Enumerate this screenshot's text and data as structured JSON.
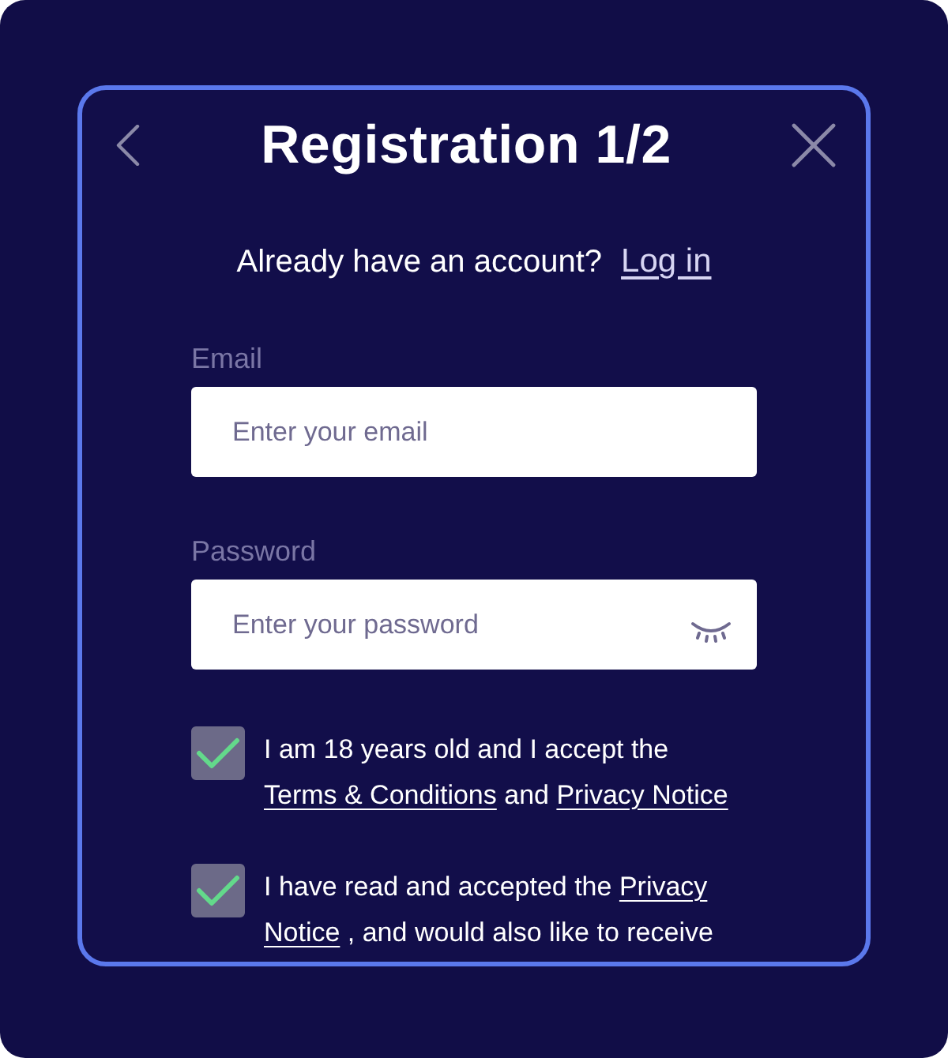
{
  "header": {
    "title": "Registration 1/2"
  },
  "login_prompt": {
    "text": "Already have an account?",
    "link": "Log in"
  },
  "fields": [
    {
      "kind": "email",
      "label": "Email",
      "placeholder": "Enter your email"
    },
    {
      "kind": "password",
      "label": "Password",
      "placeholder": "Enter your password"
    }
  ],
  "consents": [
    {
      "checked": true,
      "segments": [
        {
          "kind": "text",
          "text": "I am 18 years old and I accept the "
        },
        {
          "kind": "link",
          "text": "Terms & Conditions"
        },
        {
          "kind": "text",
          "text": " and "
        },
        {
          "kind": "link",
          "text": "Privacy Notice"
        }
      ]
    },
    {
      "checked": true,
      "segments": [
        {
          "kind": "text",
          "text": "I have read and accepted the "
        },
        {
          "kind": "link",
          "parts": [
            "Privacy",
            "Notice"
          ]
        },
        {
          "kind": "text",
          "text": " , and would also like to receive"
        }
      ]
    }
  ]
}
